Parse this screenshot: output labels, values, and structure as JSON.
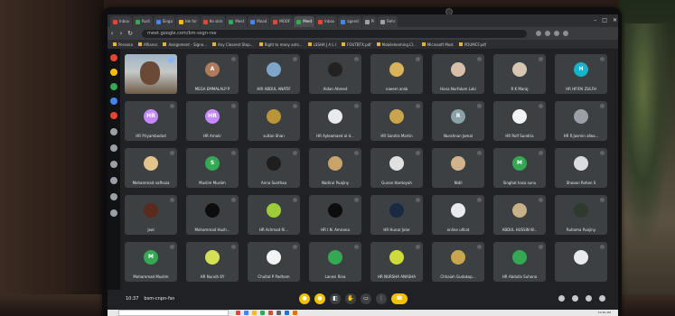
{
  "browser": {
    "tabs": [
      {
        "label": "Inbox",
        "color": "#ea4335"
      },
      {
        "label": "Rudi",
        "color": "#34a853"
      },
      {
        "label": "Singa",
        "color": "#4285f4"
      },
      {
        "label": "Ide for",
        "color": "#fbbc04"
      },
      {
        "label": "Ke skm",
        "color": "#ea4335"
      },
      {
        "label": "Meet",
        "color": "#34a853"
      },
      {
        "label": "Mood",
        "color": "#4285f4"
      },
      {
        "label": "MOOF",
        "color": "#ea4335"
      },
      {
        "label": "Meet",
        "color": "#34a853",
        "active": true
      },
      {
        "label": "Inbox",
        "color": "#ea4335"
      },
      {
        "label": "agend",
        "color": "#4285f4"
      },
      {
        "label": "Pi",
        "color": "#9aa0a6"
      },
      {
        "label": "Rehr",
        "color": "#9aa0a6"
      }
    ],
    "url": "meet.google.com/bm-ssgn-rse",
    "bookmarks": [
      "Persona",
      "Aflianss",
      "Assignment - Signe...",
      "Any Clearest Stop...",
      "Right to many ants...",
      "LSSHA J A L I",
      "FOUTBTX.pdf",
      "Mobileleaming.Cl...",
      "Microsoft Most",
      "PDUMCF.pdf"
    ]
  },
  "participants": [
    {
      "name": "",
      "initial": "",
      "color": "#5f6368",
      "self": true
    },
    {
      "name": "MEGA EMMALALP P",
      "initial": "A",
      "color": "#b07b5a"
    },
    {
      "name": "HIR ABDUL ANATIF",
      "initial": "",
      "color": "#7fa6c9"
    },
    {
      "name": "Aidan Ahmed",
      "initial": "",
      "color": "#222222"
    },
    {
      "name": "naeem arab",
      "initial": "",
      "color": "#d9b25c"
    },
    {
      "name": "Hana Nurfalum Laki",
      "initial": "",
      "color": "#d7bfa8"
    },
    {
      "name": "R K Maraj",
      "initial": "",
      "color": "#d8c7b0"
    },
    {
      "name": "HR HFIFAI ZULFH",
      "initial": "H",
      "color": "#12b5cb"
    },
    {
      "name": "HR Priyambodod",
      "initial": "HR",
      "color": "#c58af9"
    },
    {
      "name": "HR Amalir",
      "initial": "HR",
      "color": "#c58af9"
    },
    {
      "name": "sultan Shan",
      "initial": "",
      "color": "#b8953a"
    },
    {
      "name": "HR Ayleamaed al d...",
      "initial": "",
      "color": "#e8eaed"
    },
    {
      "name": "HR Sandra Martin",
      "initial": "",
      "color": "#c9a64e"
    },
    {
      "name": "Nurahnan Jamal",
      "initial": "R",
      "color": "#8aa1a8"
    },
    {
      "name": "HR Rolf Sundria",
      "initial": "",
      "color": "#f1f3f4"
    },
    {
      "name": "HR R.Jasmin afwa...",
      "initial": "",
      "color": "#9aa0a6"
    },
    {
      "name": "Mohammad nafhaza",
      "initial": "",
      "color": "#e3c48d"
    },
    {
      "name": "Muslim Muslim",
      "initial": "S",
      "color": "#34a853"
    },
    {
      "name": "Anna Sunthaa",
      "initial": "",
      "color": "#1e1e1e"
    },
    {
      "name": "Nadirul Puajiny",
      "initial": "",
      "color": "#c9a46a"
    },
    {
      "name": "Gunan Hantoyah",
      "initial": "",
      "color": "#e0e0e0"
    },
    {
      "name": "Nidil",
      "initial": "",
      "color": "#d2b48c"
    },
    {
      "name": "Singhal hasa sunu",
      "initial": "M",
      "color": "#34a853"
    },
    {
      "name": "Shaoon Rohan S",
      "initial": "",
      "color": "#dadce0"
    },
    {
      "name": "Joel",
      "initial": "",
      "color": "#5a2a1e"
    },
    {
      "name": "Mohammad Huzh...",
      "initial": "",
      "color": "#0d0d0d"
    },
    {
      "name": "HR Achmad Ri...",
      "initial": "",
      "color": "#9ccc3a"
    },
    {
      "name": "HR I.N. Amirona",
      "initial": "",
      "color": "#0d0d0d"
    },
    {
      "name": "HR Hunar Jolor",
      "initial": "",
      "color": "#1a2a44"
    },
    {
      "name": "online ulfcat",
      "initial": "",
      "color": "#e8eaed"
    },
    {
      "name": "ABDUL HUSSIN W...",
      "initial": "",
      "color": "#c8b08a"
    },
    {
      "name": "Ruhama Puajiny",
      "initial": "",
      "color": "#2e3a2e"
    },
    {
      "name": "Mohammad Muslim",
      "initial": "M",
      "color": "#34a853"
    },
    {
      "name": "HR Nurulh 6Y",
      "initial": "",
      "color": "#d4e157"
    },
    {
      "name": "Chultal P Padham",
      "initial": "",
      "color": "#f1f3f4"
    },
    {
      "name": "Lanesi Rina",
      "initial": "",
      "color": "#34a853"
    },
    {
      "name": "HR NURSHA ANASHA",
      "initial": "",
      "color": "#cddc39"
    },
    {
      "name": "Chhaiah Gudakop...",
      "initial": "",
      "color": "#c9a64e"
    },
    {
      "name": "HR Abdulla Suhana",
      "initial": "",
      "color": "#34a853"
    },
    {
      "name": "",
      "initial": "",
      "color": "#e8eaed"
    }
  ],
  "meeting": {
    "time": "10:37",
    "code": "bsm-cnpn-fsn"
  },
  "taskbar": {
    "clock": "10:40 AM"
  }
}
